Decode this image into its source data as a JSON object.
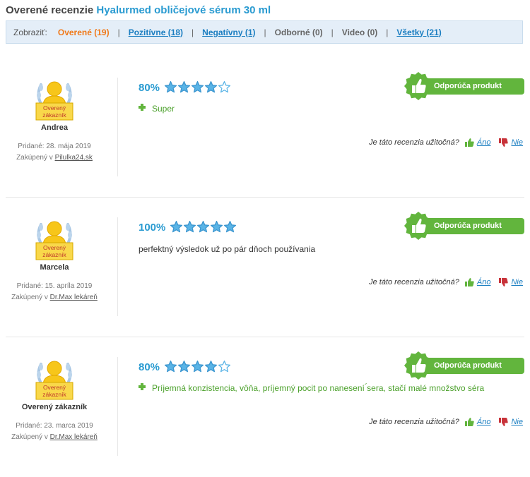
{
  "header": {
    "title_prefix": "Overené recenzie",
    "title_product": "Hyalurmed obličejové sérum 30 ml"
  },
  "filters": {
    "label": "Zobraziť:",
    "items": [
      {
        "label": "Overené (19)",
        "state": "active"
      },
      {
        "label": "Pozitívne (18)",
        "state": "link"
      },
      {
        "label": "Negatívny (1)",
        "state": "link"
      },
      {
        "label": "Odborné (0)",
        "state": "muted"
      },
      {
        "label": "Video (0)",
        "state": "muted"
      },
      {
        "label": "Všetky (21)",
        "state": "link"
      }
    ]
  },
  "badge_text": [
    "Overený",
    "zákazník"
  ],
  "reviews": [
    {
      "name": "Andrea",
      "date": "Pridané: 28. mája 2019",
      "bought_prefix": "Zakúpený v",
      "shop": "Pilulka24.sk",
      "percent": "80%",
      "rating": 4,
      "kind": "pro",
      "text": "Super"
    },
    {
      "name": "Marcela",
      "date": "Pridané: 15. apríla 2019",
      "bought_prefix": "Zakúpený v",
      "shop": "Dr.Max lekáreň",
      "percent": "100%",
      "rating": 5,
      "kind": "plain",
      "text": "perfektný výsledok už po pár dňoch používania"
    },
    {
      "name": "Overený zákazník",
      "date": "Pridané: 23. marca 2019",
      "bought_prefix": "Zakúpený v",
      "shop": "Dr.Max lekáreň",
      "percent": "80%",
      "rating": 4,
      "kind": "pro",
      "text": "Príjemná konzistencia, vôňa, príjemný pocit po nanesení ́sera, stačí malé množstvo séra"
    }
  ],
  "recommend_label": "Odporúča produkt",
  "helpful": {
    "question": "Je táto recenzia užitočná?",
    "yes": "Áno",
    "no": "Nie"
  },
  "colors": {
    "accent_blue": "#2a9bd1",
    "active_orange": "#f07a1b",
    "green": "#62b53d",
    "star_fill": "#5ab4e6",
    "no_red": "#c8333a"
  }
}
